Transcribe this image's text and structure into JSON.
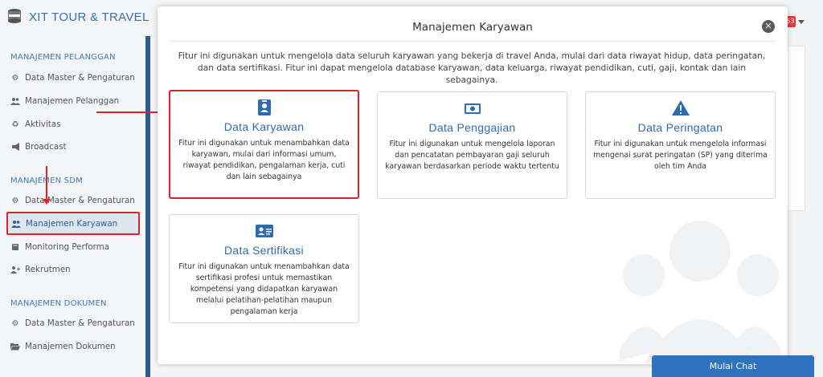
{
  "brand": {
    "name": "XIT TOUR & TRAVEL"
  },
  "sidebar": {
    "sections": [
      {
        "title": "MANAJEMEN PELANGGAN",
        "items": [
          {
            "label": "Data Master & Pengaturan",
            "icon": "gears-icon"
          },
          {
            "label": "Manajemen Pelanggan",
            "icon": "users-icon"
          },
          {
            "label": "Aktivitas",
            "icon": "recycle-icon"
          },
          {
            "label": "Broadcast",
            "icon": "bullhorn-icon"
          }
        ]
      },
      {
        "title": "MANAJEMEN SDM",
        "items": [
          {
            "label": "Data Master & Pengaturan",
            "icon": "gears-icon"
          },
          {
            "label": "Manajemen Karyawan",
            "icon": "users-icon",
            "active": true
          },
          {
            "label": "Monitoring Performa",
            "icon": "book-icon"
          },
          {
            "label": "Rekrutmen",
            "icon": "user-plus-icon"
          }
        ]
      },
      {
        "title": "MANAJEMEN DOKUMEN",
        "items": [
          {
            "label": "Data Master & Pengaturan",
            "icon": "gears-icon"
          },
          {
            "label": "Manajemen Dokumen",
            "icon": "folder-open-icon"
          }
        ]
      }
    ]
  },
  "header": {
    "notification_count": "53"
  },
  "modal": {
    "title": "Manajemen Karyawan",
    "description": "Fitur ini digunakan untuk mengelola data seluruh karyawan yang bekerja di travel Anda, mulai dari data riwayat hidup, data peringatan, dan data sertifikasi. Fitur ini dapat mengelola database karyawan, data keluarga, riwayat pendidikan, cuti, gaji, kontak dan lain sebagainya.",
    "cards": [
      {
        "title": "Data Karyawan",
        "icon": "id-badge-icon",
        "description": "Fitur ini digunakan untuk menambahkan data karyawan, mulai dari informasi umum, riwayat pendidikan, pengalaman kerja, cuti dan lain sebagainya"
      },
      {
        "title": "Data Penggajian",
        "icon": "money-bill-icon",
        "description": "Fitur ini digunakan untuk mengelola laporan dan pencatatan pembayaran gaji seluruh karyawan berdasarkan periode waktu tertentu"
      },
      {
        "title": "Data Peringatan",
        "icon": "warning-icon",
        "description": "Fitur ini digunakan untuk mengelola informasi mengenai surat peringatan (SP) yang diterima oleh tim Anda"
      },
      {
        "title": "Data Sertifikasi",
        "icon": "address-card-icon",
        "description": "Fitur ini digunakan untuk menambahkan data sertifikasi profesi untuk memastikan kompetensi yang didapatkan karyawan melalui pelatihan-pelatihan maupun pengalaman kerja"
      }
    ]
  },
  "chat": {
    "label": "Mulai Chat"
  },
  "colors": {
    "accent": "#2f6bb0",
    "annotation": "#d9232d",
    "sidebar_dark": "#2c5b90"
  }
}
